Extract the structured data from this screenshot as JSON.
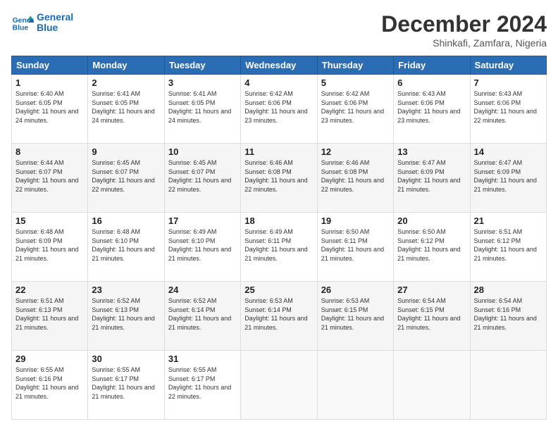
{
  "logo": {
    "line1": "General",
    "line2": "Blue"
  },
  "title": "December 2024",
  "subtitle": "Shinkafi, Zamfara, Nigeria",
  "headers": [
    "Sunday",
    "Monday",
    "Tuesday",
    "Wednesday",
    "Thursday",
    "Friday",
    "Saturday"
  ],
  "weeks": [
    [
      {
        "day": "1",
        "sunrise": "6:40 AM",
        "sunset": "6:05 PM",
        "daylight": "11 hours and 24 minutes."
      },
      {
        "day": "2",
        "sunrise": "6:41 AM",
        "sunset": "6:05 PM",
        "daylight": "11 hours and 24 minutes."
      },
      {
        "day": "3",
        "sunrise": "6:41 AM",
        "sunset": "6:05 PM",
        "daylight": "11 hours and 24 minutes."
      },
      {
        "day": "4",
        "sunrise": "6:42 AM",
        "sunset": "6:06 PM",
        "daylight": "11 hours and 23 minutes."
      },
      {
        "day": "5",
        "sunrise": "6:42 AM",
        "sunset": "6:06 PM",
        "daylight": "11 hours and 23 minutes."
      },
      {
        "day": "6",
        "sunrise": "6:43 AM",
        "sunset": "6:06 PM",
        "daylight": "11 hours and 23 minutes."
      },
      {
        "day": "7",
        "sunrise": "6:43 AM",
        "sunset": "6:06 PM",
        "daylight": "11 hours and 22 minutes."
      }
    ],
    [
      {
        "day": "8",
        "sunrise": "6:44 AM",
        "sunset": "6:07 PM",
        "daylight": "11 hours and 22 minutes."
      },
      {
        "day": "9",
        "sunrise": "6:45 AM",
        "sunset": "6:07 PM",
        "daylight": "11 hours and 22 minutes."
      },
      {
        "day": "10",
        "sunrise": "6:45 AM",
        "sunset": "6:07 PM",
        "daylight": "11 hours and 22 minutes."
      },
      {
        "day": "11",
        "sunrise": "6:46 AM",
        "sunset": "6:08 PM",
        "daylight": "11 hours and 22 minutes."
      },
      {
        "day": "12",
        "sunrise": "6:46 AM",
        "sunset": "6:08 PM",
        "daylight": "11 hours and 22 minutes."
      },
      {
        "day": "13",
        "sunrise": "6:47 AM",
        "sunset": "6:09 PM",
        "daylight": "11 hours and 21 minutes."
      },
      {
        "day": "14",
        "sunrise": "6:47 AM",
        "sunset": "6:09 PM",
        "daylight": "11 hours and 21 minutes."
      }
    ],
    [
      {
        "day": "15",
        "sunrise": "6:48 AM",
        "sunset": "6:09 PM",
        "daylight": "11 hours and 21 minutes."
      },
      {
        "day": "16",
        "sunrise": "6:48 AM",
        "sunset": "6:10 PM",
        "daylight": "11 hours and 21 minutes."
      },
      {
        "day": "17",
        "sunrise": "6:49 AM",
        "sunset": "6:10 PM",
        "daylight": "11 hours and 21 minutes."
      },
      {
        "day": "18",
        "sunrise": "6:49 AM",
        "sunset": "6:11 PM",
        "daylight": "11 hours and 21 minutes."
      },
      {
        "day": "19",
        "sunrise": "6:50 AM",
        "sunset": "6:11 PM",
        "daylight": "11 hours and 21 minutes."
      },
      {
        "day": "20",
        "sunrise": "6:50 AM",
        "sunset": "6:12 PM",
        "daylight": "11 hours and 21 minutes."
      },
      {
        "day": "21",
        "sunrise": "6:51 AM",
        "sunset": "6:12 PM",
        "daylight": "11 hours and 21 minutes."
      }
    ],
    [
      {
        "day": "22",
        "sunrise": "6:51 AM",
        "sunset": "6:13 PM",
        "daylight": "11 hours and 21 minutes."
      },
      {
        "day": "23",
        "sunrise": "6:52 AM",
        "sunset": "6:13 PM",
        "daylight": "11 hours and 21 minutes."
      },
      {
        "day": "24",
        "sunrise": "6:52 AM",
        "sunset": "6:14 PM",
        "daylight": "11 hours and 21 minutes."
      },
      {
        "day": "25",
        "sunrise": "6:53 AM",
        "sunset": "6:14 PM",
        "daylight": "11 hours and 21 minutes."
      },
      {
        "day": "26",
        "sunrise": "6:53 AM",
        "sunset": "6:15 PM",
        "daylight": "11 hours and 21 minutes."
      },
      {
        "day": "27",
        "sunrise": "6:54 AM",
        "sunset": "6:15 PM",
        "daylight": "11 hours and 21 minutes."
      },
      {
        "day": "28",
        "sunrise": "6:54 AM",
        "sunset": "6:16 PM",
        "daylight": "11 hours and 21 minutes."
      }
    ],
    [
      {
        "day": "29",
        "sunrise": "6:55 AM",
        "sunset": "6:16 PM",
        "daylight": "11 hours and 21 minutes."
      },
      {
        "day": "30",
        "sunrise": "6:55 AM",
        "sunset": "6:17 PM",
        "daylight": "11 hours and 21 minutes."
      },
      {
        "day": "31",
        "sunrise": "6:55 AM",
        "sunset": "6:17 PM",
        "daylight": "11 hours and 22 minutes."
      },
      null,
      null,
      null,
      null
    ]
  ],
  "labels": {
    "sunrise": "Sunrise:",
    "sunset": "Sunset:",
    "daylight": "Daylight:"
  }
}
